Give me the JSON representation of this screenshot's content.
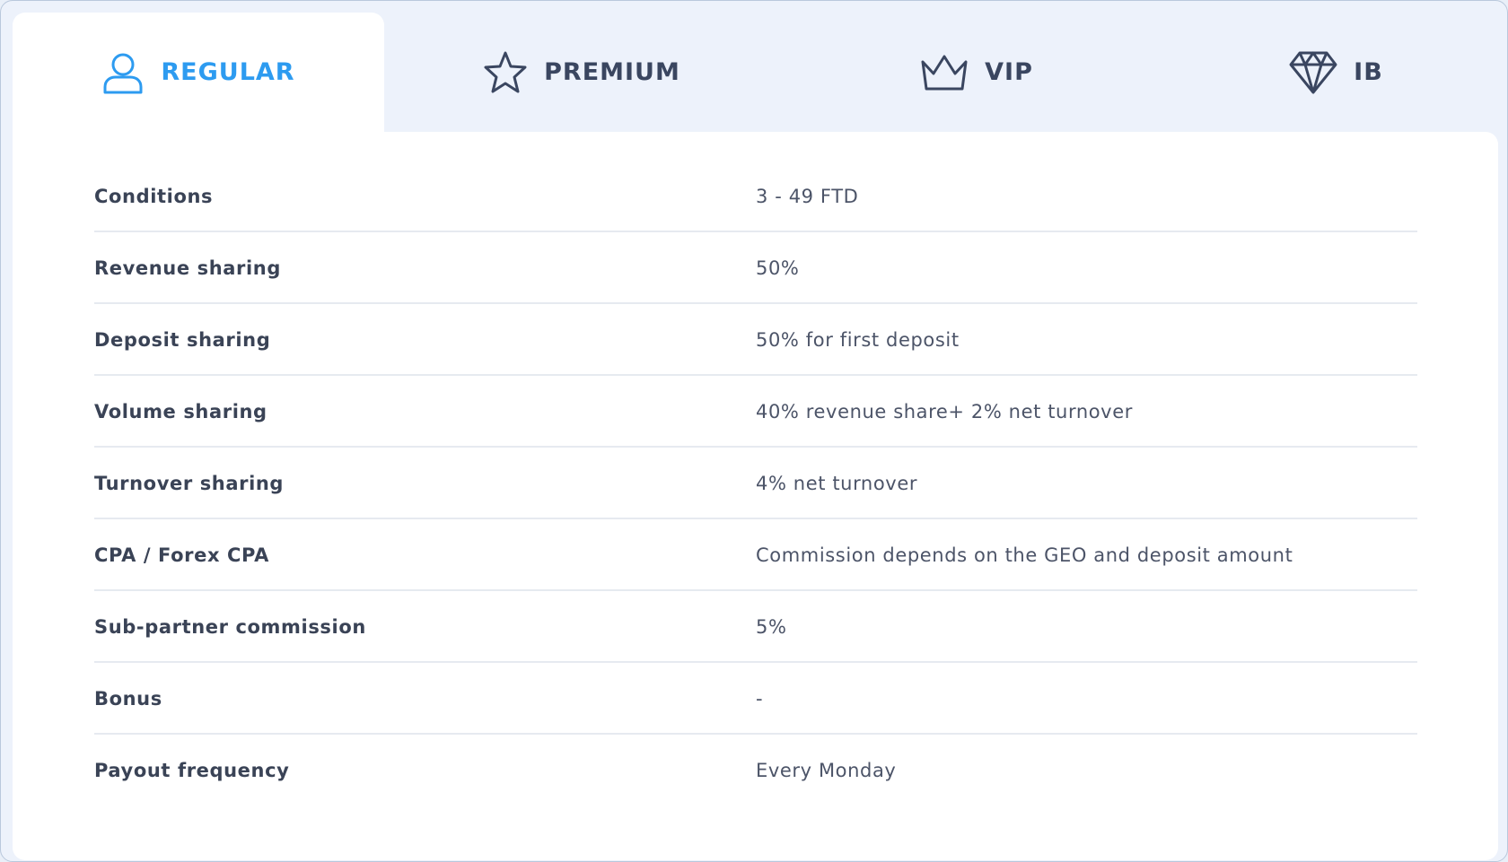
{
  "tabs": [
    {
      "label": "REGULAR",
      "icon": "user-icon",
      "active": true
    },
    {
      "label": "PREMIUM",
      "icon": "star-icon",
      "active": false
    },
    {
      "label": "VIP",
      "icon": "crown-icon",
      "active": false
    },
    {
      "label": "IB",
      "icon": "diamond-icon",
      "active": false
    }
  ],
  "colors": {
    "accent": "#2d9bf0",
    "tab_text": "#3a4660",
    "row_label": "#3a4356",
    "row_value": "#4c5468"
  },
  "table": {
    "rows": [
      {
        "label": "Conditions",
        "value": "3 - 49 FTD"
      },
      {
        "label": "Revenue sharing",
        "value": "50%"
      },
      {
        "label": "Deposit sharing",
        "value": "50% for first deposit"
      },
      {
        "label": "Volume sharing",
        "value": "40% revenue share+ 2% net turnover"
      },
      {
        "label": "Turnover sharing",
        "value": "4% net turnover"
      },
      {
        "label": "CPA / Forex CPA",
        "value": "Commission depends on the GEO and deposit amount"
      },
      {
        "label": "Sub-partner commission",
        "value": "5%"
      },
      {
        "label": "Bonus",
        "value": "-"
      },
      {
        "label": "Payout frequency",
        "value": "Every Monday"
      }
    ]
  }
}
